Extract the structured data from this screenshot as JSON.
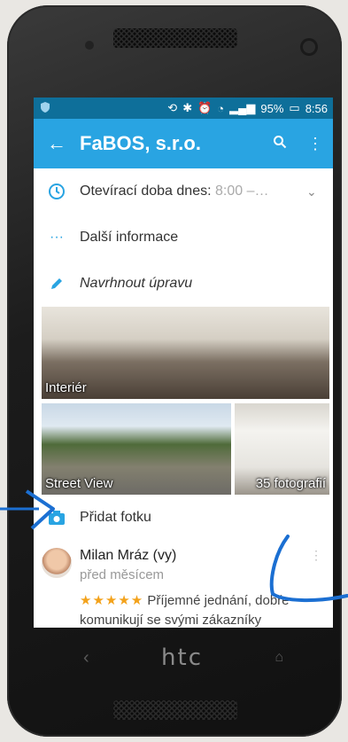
{
  "status": {
    "battery": "95%",
    "time": "8:56"
  },
  "appbar": {
    "title": "FaBOS, s.r.o."
  },
  "hours": {
    "label": "Otevírací doba dnes:",
    "value": "8:00 –…"
  },
  "more_info": {
    "label": "Další informace"
  },
  "suggest_edit": {
    "label": "Navrhnout úpravu"
  },
  "photos": {
    "interior": "Interiér",
    "street_view": "Street View",
    "count": "35 fotografií"
  },
  "add_photo": {
    "label": "Přidat fotku"
  },
  "review": {
    "name": "Milan Mráz (vy)",
    "when": "před měsícem",
    "stars": "★★★★★",
    "text": "Příjemné jednání, dobře komunikují se svými zákazníky"
  },
  "device": {
    "brand": "htc"
  },
  "colors": {
    "accent": "#29a4e2",
    "status_bar": "#0e6f9a",
    "stars": "#f3a21b",
    "annotation": "#1b6fd2"
  }
}
